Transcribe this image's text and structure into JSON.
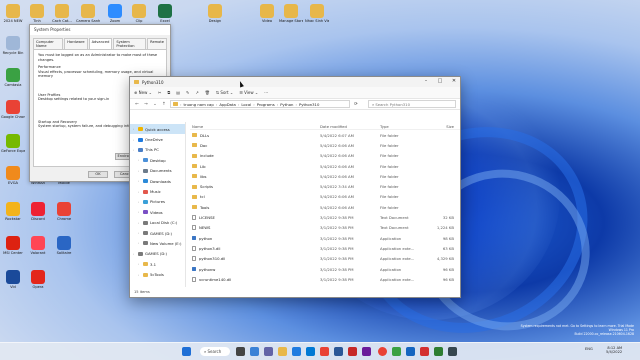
{
  "desktop_icons": [
    {
      "label": "2024 NEW",
      "color": "#e7b74a"
    },
    {
      "label": "Tinh",
      "color": "#e7b74a"
    },
    {
      "label": "Cach Cat...",
      "color": "#e7b74a"
    },
    {
      "label": "Camera Sanh",
      "color": "#e7b74a"
    },
    {
      "label": "Zoom",
      "color": "#2d8cff"
    },
    {
      "label": "Clip",
      "color": "#e7b74a"
    },
    {
      "label": "Excel",
      "color": "#1e7145"
    },
    {
      "label": "Design",
      "color": "#e7b74a"
    },
    {
      "label": "Video",
      "color": "#e7b74a"
    },
    {
      "label": "Manage Store",
      "color": "#e7b74a"
    },
    {
      "label": "Nhac Sinh Vien",
      "color": "#e7b74a"
    },
    {
      "label": "Recycle Bin",
      "color": "#9fb7d8"
    },
    {
      "label": "Camtasia",
      "color": "#3aa143"
    },
    {
      "label": "Google Chrome",
      "color": "#e94235"
    },
    {
      "label": "GeForce Experience",
      "color": "#76b900"
    },
    {
      "label": "EVGA",
      "color": "#f08a1c"
    },
    {
      "label": "WinRAR",
      "color": "#7b3f9e"
    },
    {
      "label": "Mobile",
      "color": "#d33"
    },
    {
      "label": "Rockstar",
      "color": "#f3b31a"
    },
    {
      "label": "Discord",
      "color": "#e23"
    },
    {
      "label": "Chrome",
      "color": "#e94235"
    },
    {
      "label": "MSI Center",
      "color": "#d21"
    },
    {
      "label": "Valorant",
      "color": "#ff4655"
    },
    {
      "label": "Solitaire",
      "color": "#2a66c4"
    },
    {
      "label": "Vid",
      "color": "#1a4a9a"
    },
    {
      "label": "Opera",
      "color": "#e3261b"
    }
  ],
  "system_properties": {
    "title": "System Properties",
    "tabs": [
      "Computer Name",
      "Hardware",
      "Advanced",
      "System Protection",
      "Remote"
    ],
    "note": "You must be logged on as an Administrator to make most of these changes.",
    "performance_title": "Performance",
    "performance_desc": "Visual effects, processor scheduling, memory usage, and virtual memory",
    "profiles_title": "User Profiles",
    "profiles_desc": "Desktop settings related to your sign-in",
    "startup_title": "Startup and Recovery",
    "startup_desc": "System startup, system failure, and debugging information",
    "env_button": "Environ...",
    "ok": "OK",
    "cancel": "Cancel"
  },
  "explorer": {
    "title": "Python310",
    "toolbar": {
      "new": "New",
      "sort": "Sort",
      "view": "View",
      "more": "···"
    },
    "breadcrumb": [
      "truong nam cap",
      "AppData",
      "Local",
      "Programs",
      "Python",
      "Python310"
    ],
    "search_placeholder": "Search Python310",
    "nav": [
      {
        "label": "Quick access",
        "color": "#f0b400",
        "selected": true
      },
      {
        "label": "OneDrive",
        "color": "#1f7be0"
      },
      {
        "label": "This PC",
        "color": "#4a7fc7"
      },
      {
        "label": "Desktop",
        "color": "#4a90d9"
      },
      {
        "label": "Documents",
        "color": "#6c7b8b"
      },
      {
        "label": "Downloads",
        "color": "#2b8ad8"
      },
      {
        "label": "Music",
        "color": "#e2574c"
      },
      {
        "label": "Pictures",
        "color": "#3aa0d8"
      },
      {
        "label": "Videos",
        "color": "#7a4fc4"
      },
      {
        "label": "Local Disk (C:)",
        "color": "#7a7a7a"
      },
      {
        "label": "GAMES (D:)",
        "color": "#7a7a7a"
      },
      {
        "label": "New Volume (E:)",
        "color": "#7a7a7a"
      },
      {
        "label": "GAMES (D:)",
        "color": "#7a7a7a"
      },
      {
        "label": "3.1",
        "color": "#e8b84a"
      },
      {
        "label": "5cTools",
        "color": "#e8b84a"
      }
    ],
    "columns": {
      "name": "Name",
      "date": "Date modified",
      "type": "Type",
      "size": "Size"
    },
    "files": [
      {
        "name": "DLLs",
        "date": "5/4/2022 6:07 AM",
        "type": "File folder",
        "size": "",
        "kind": "folder"
      },
      {
        "name": "Doc",
        "date": "5/4/2022 6:06 AM",
        "type": "File folder",
        "size": "",
        "kind": "folder"
      },
      {
        "name": "include",
        "date": "5/4/2022 6:06 AM",
        "type": "File folder",
        "size": "",
        "kind": "folder"
      },
      {
        "name": "Lib",
        "date": "5/4/2022 6:06 AM",
        "type": "File folder",
        "size": "",
        "kind": "folder"
      },
      {
        "name": "libs",
        "date": "5/4/2022 6:06 AM",
        "type": "File folder",
        "size": "",
        "kind": "folder"
      },
      {
        "name": "Scripts",
        "date": "5/4/2022 3:34 AM",
        "type": "File folder",
        "size": "",
        "kind": "folder"
      },
      {
        "name": "tcl",
        "date": "5/4/2022 6:06 AM",
        "type": "File folder",
        "size": "",
        "kind": "folder"
      },
      {
        "name": "Tools",
        "date": "5/4/2022 6:06 AM",
        "type": "File folder",
        "size": "",
        "kind": "folder"
      },
      {
        "name": "LICENSE",
        "date": "3/1/2022 9:38 PM",
        "type": "Text Document",
        "size": "32 KB",
        "kind": "file"
      },
      {
        "name": "NEWS",
        "date": "3/1/2022 9:38 PM",
        "type": "Text Document",
        "size": "1,224 KB",
        "kind": "file"
      },
      {
        "name": "python",
        "date": "3/1/2022 9:38 PM",
        "type": "Application",
        "size": "98 KB",
        "kind": "app"
      },
      {
        "name": "python3.dll",
        "date": "3/1/2022 9:38 PM",
        "type": "Application exte...",
        "size": "63 KB",
        "kind": "file"
      },
      {
        "name": "python310.dll",
        "date": "3/1/2022 9:38 PM",
        "type": "Application exte...",
        "size": "4,329 KB",
        "kind": "file"
      },
      {
        "name": "pythonw",
        "date": "3/1/2022 9:38 PM",
        "type": "Application",
        "size": "96 KB",
        "kind": "app"
      },
      {
        "name": "vcruntime140.dll",
        "date": "3/1/2022 9:38 PM",
        "type": "Application exte...",
        "size": "96 KB",
        "kind": "file"
      }
    ],
    "status": "15 items"
  },
  "taskbar": {
    "search": "Search",
    "lang": "ENG",
    "time": "8:12 AM",
    "date": "5/4/2022"
  },
  "watermark": {
    "line1": "System requirements not met. Go to Settings to learn more. Trial Mode",
    "line2": "Windows 11 Pro",
    "line3": "Build 22000.co_release.210604-1628"
  }
}
